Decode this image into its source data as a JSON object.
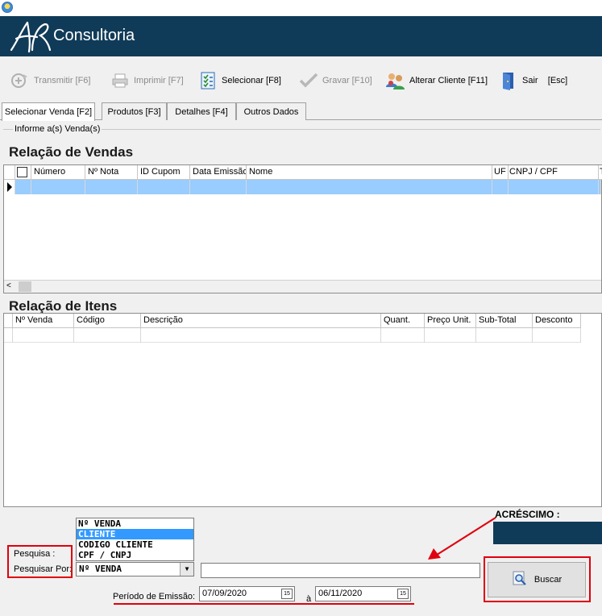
{
  "brand": "Consultoria",
  "toolbar": {
    "transmitir": "Transmitir [F6]",
    "imprimir": "Imprimir  [F7]",
    "selecionar": "Selecionar [F8]",
    "gravar": "Gravar [F10]",
    "alterar_cliente": "Alterar Cliente [F11]",
    "sair": "Sair    [Esc]"
  },
  "tabs": [
    "Selecionar Venda [F2]",
    "Produtos [F3]",
    "Detalhes [F4]",
    "Outros Dados"
  ],
  "group_label": "Informe a(s) Venda(s)",
  "vendas": {
    "title": "Relação de Vendas",
    "columns": [
      "Número",
      "Nº Nota",
      "ID Cupom",
      "Data Emissão",
      "Nome",
      "UF",
      "CNPJ / CPF",
      "T"
    ]
  },
  "itens": {
    "title": "Relação de Itens",
    "columns": [
      "Nº Venda",
      "Código",
      "Descrição",
      "Quant.",
      "Preço Unit.",
      "Sub-Total",
      "Desconto"
    ]
  },
  "acrescimo_label": "ACRÉSCIMO :",
  "pesquisa": {
    "label": "Pesquisa :",
    "pesquisar_por_label": "Pesquisar Por:",
    "selected": "Nº VENDA",
    "options": [
      "Nº VENDA",
      "CLIENTE",
      "CODIGO CLIENTE",
      "CPF / CNPJ"
    ],
    "highlighted_option": "CLIENTE",
    "search_value": ""
  },
  "periodo": {
    "label": "Período de Emissão:",
    "from": "07/09/2020",
    "separator": "à",
    "to": "06/11/2020",
    "calendar_glyph": "15"
  },
  "buscar_label": "Buscar",
  "colors": {
    "banner": "#103b58",
    "selected_row": "#99ccff",
    "highlight_red": "#e0000f",
    "dropdown_selection": "#3399ff"
  }
}
